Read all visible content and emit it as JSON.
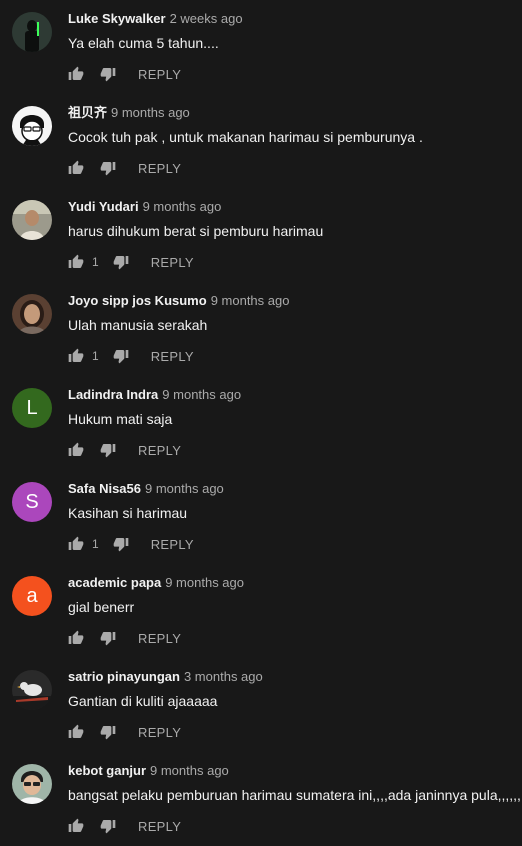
{
  "comments": [
    {
      "author": "Luke Skywalker",
      "time": "2 weeks ago",
      "text": "Ya elah cuma 5 tahun....",
      "likes": "",
      "avatar": {
        "type": "photo",
        "icon": "figure-dark-avatar",
        "color": "#1c2a24"
      }
    },
    {
      "author": "祖贝齐",
      "time": "9 months ago",
      "text": "Cocok tuh pak , untuk makanan harimau si pemburunya .",
      "likes": "",
      "avatar": {
        "type": "photo",
        "icon": "cartoon-face-avatar",
        "color": "#f5f5f5"
      }
    },
    {
      "author": "Yudi Yudari",
      "time": "9 months ago",
      "text": "harus dihukum berat si pemburu harimau",
      "likes": "1",
      "avatar": {
        "type": "photo",
        "icon": "person-photo-avatar",
        "color": "#b8a58c"
      }
    },
    {
      "author": "Joyo sipp jos Kusumo",
      "time": "9 months ago",
      "text": "Ulah manusia serakah",
      "likes": "1",
      "avatar": {
        "type": "photo",
        "icon": "person-photo-avatar",
        "color": "#5a4032"
      }
    },
    {
      "author": "Ladindra Indra",
      "time": "9 months ago",
      "text": "Hukum mati saja",
      "likes": "",
      "avatar": {
        "type": "letter",
        "letter": "L",
        "color": "#33691e"
      }
    },
    {
      "author": "Safa Nisa56",
      "time": "9 months ago",
      "text": "Kasihan si harimau",
      "likes": "1",
      "avatar": {
        "type": "letter",
        "letter": "S",
        "color": "#ab47bc"
      }
    },
    {
      "author": "academic papa",
      "time": "9 months ago",
      "text": "gial benerr",
      "likes": "",
      "avatar": {
        "type": "letter",
        "letter": "a",
        "color": "#f4511e"
      }
    },
    {
      "author": "satrio pinayungan",
      "time": "3 months ago",
      "text": "Gantian di kuliti ajaaaaa",
      "likes": "",
      "avatar": {
        "type": "photo",
        "icon": "bird-photo-avatar",
        "color": "#2a2a2a"
      }
    },
    {
      "author": "kebot ganjur",
      "time": "9 months ago",
      "text": "bangsat pelaku pemburuan harimau sumatera ini,,,,ada janinnya pula,,,,,,",
      "likes": "",
      "avatar": {
        "type": "photo",
        "icon": "person-photo-avatar",
        "color": "#9fb5a8"
      }
    }
  ],
  "reply_label": "REPLY",
  "colors": {
    "background": "#181818",
    "text_primary": "#f1f1f1",
    "text_secondary": "#aaaaaa"
  }
}
